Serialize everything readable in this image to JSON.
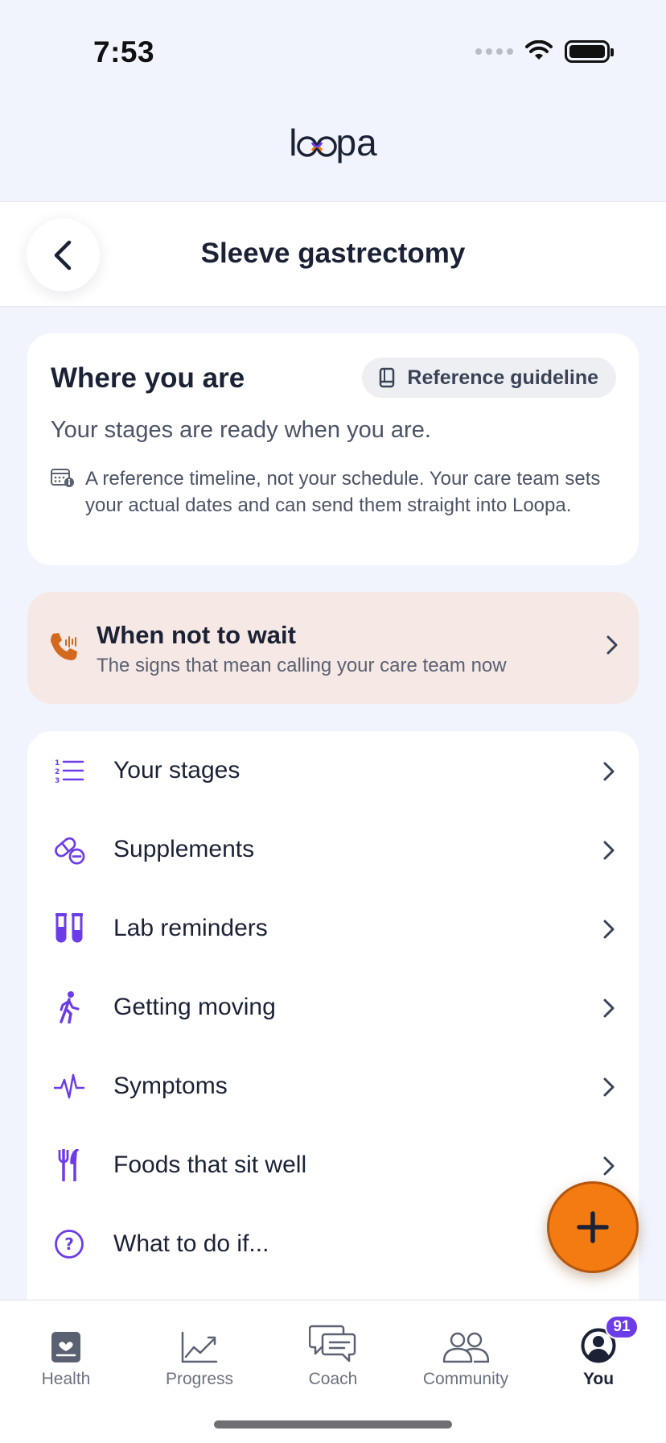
{
  "status_bar": {
    "time": "7:53"
  },
  "brand": {
    "name_start": "l",
    "name_end": "pa"
  },
  "header": {
    "title": "Sleeve gastrectomy"
  },
  "where": {
    "heading": "Where you are",
    "reference_label": "Reference guideline",
    "subtitle": "Your stages are ready when you are.",
    "note": "A reference timeline, not your schedule. Your care team sets your actual dates and can send them straight into Loopa."
  },
  "wait": {
    "title": "When not to wait",
    "subtitle": "The signs that mean calling your care team now"
  },
  "menu": {
    "items": [
      {
        "label": "Your stages",
        "icon": "numbered-list-icon"
      },
      {
        "label": "Supplements",
        "icon": "pill-icon"
      },
      {
        "label": "Lab reminders",
        "icon": "test-tubes-icon"
      },
      {
        "label": "Getting moving",
        "icon": "walking-icon"
      },
      {
        "label": "Symptoms",
        "icon": "pulse-icon"
      },
      {
        "label": "Foods that sit well",
        "icon": "utensils-icon"
      },
      {
        "label": "What to do if...",
        "icon": "question-icon"
      }
    ]
  },
  "tabs": [
    {
      "label": "Health",
      "icon": "health-icon"
    },
    {
      "label": "Progress",
      "icon": "chart-icon"
    },
    {
      "label": "Coach",
      "icon": "chat-icon"
    },
    {
      "label": "Community",
      "icon": "people-icon"
    },
    {
      "label": "You",
      "icon": "profile-icon",
      "badge": "91",
      "active": true
    }
  ],
  "colors": {
    "accent": "#6C3CE9",
    "fab": "#F47A12",
    "wait_bg": "#F6E8E4",
    "background": "#F1F4FC"
  }
}
